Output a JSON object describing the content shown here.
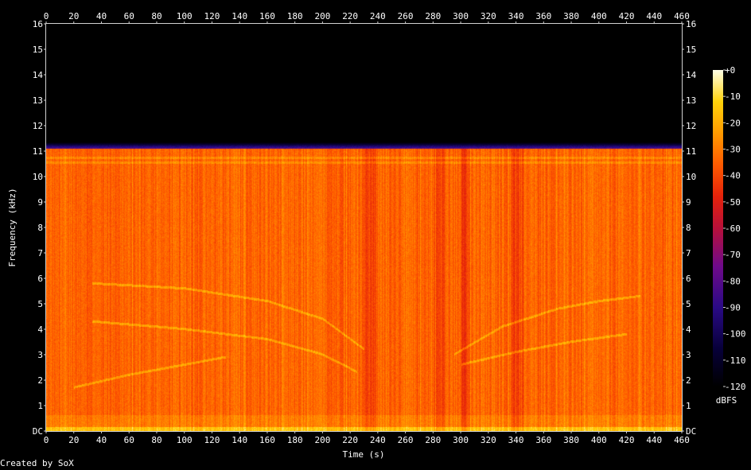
{
  "chart_data": {
    "type": "heatmap",
    "subtype": "spectrogram",
    "title": "",
    "xlabel": "Time (s)",
    "ylabel": "Frequency (kHz)",
    "xlim": [
      0,
      460
    ],
    "ylim": [
      0,
      16
    ],
    "x_ticks": [
      0,
      20,
      40,
      60,
      80,
      100,
      120,
      140,
      160,
      180,
      200,
      220,
      240,
      260,
      280,
      300,
      320,
      340,
      360,
      380,
      400,
      420,
      440,
      460
    ],
    "x_tick_labels": [
      "0",
      "20",
      "40",
      "60",
      "80",
      "100",
      "120",
      "140",
      "160",
      "180",
      "200",
      "220",
      "240",
      "260",
      "280",
      "300",
      "320",
      "340",
      "360",
      "380",
      "400",
      "420",
      "440",
      "460"
    ],
    "y_ticks": [
      0,
      1,
      2,
      3,
      4,
      5,
      6,
      7,
      8,
      9,
      10,
      11,
      12,
      13,
      14,
      15,
      16
    ],
    "y_tick_labels": [
      "DC",
      "1",
      "2",
      "3",
      "4",
      "5",
      "6",
      "7",
      "8",
      "9",
      "10",
      "11",
      "12",
      "13",
      "14",
      "15",
      "16"
    ],
    "colorbar": {
      "label": "dBFS",
      "range": [
        -120,
        0
      ],
      "ticks": [
        0,
        -10,
        -20,
        -30,
        -40,
        -50,
        -60,
        -70,
        -80,
        -90,
        -100,
        -110,
        -120
      ],
      "tick_labels": [
        "+0",
        "-10",
        "-20",
        "-30",
        "-40",
        "-50",
        "-60",
        "-70",
        "-80",
        "-90",
        "-100",
        "-110",
        "-120"
      ]
    },
    "energy_cutoff_khz": 11.1,
    "dark_time_bands_s": [
      [
        230,
        238
      ],
      [
        282,
        288
      ],
      [
        300,
        306
      ],
      [
        336,
        346
      ]
    ],
    "tonal_traces": [
      {
        "x": [
          33,
          100,
          160,
          200,
          230
        ],
        "y": [
          5.8,
          5.6,
          5.1,
          4.4,
          3.2
        ]
      },
      {
        "x": [
          33,
          100,
          160,
          200,
          225
        ],
        "y": [
          4.3,
          4.0,
          3.6,
          3.0,
          2.3
        ]
      },
      {
        "x": [
          20,
          60,
          100,
          130
        ],
        "y": [
          1.7,
          2.2,
          2.6,
          2.9
        ]
      },
      {
        "x": [
          295,
          330,
          370,
          400,
          430
        ],
        "y": [
          3.0,
          4.1,
          4.8,
          5.1,
          5.3
        ]
      },
      {
        "x": [
          300,
          340,
          380,
          420
        ],
        "y": [
          2.6,
          3.1,
          3.5,
          3.8
        ]
      }
    ]
  },
  "footer": {
    "credit": "Created by SoX"
  }
}
